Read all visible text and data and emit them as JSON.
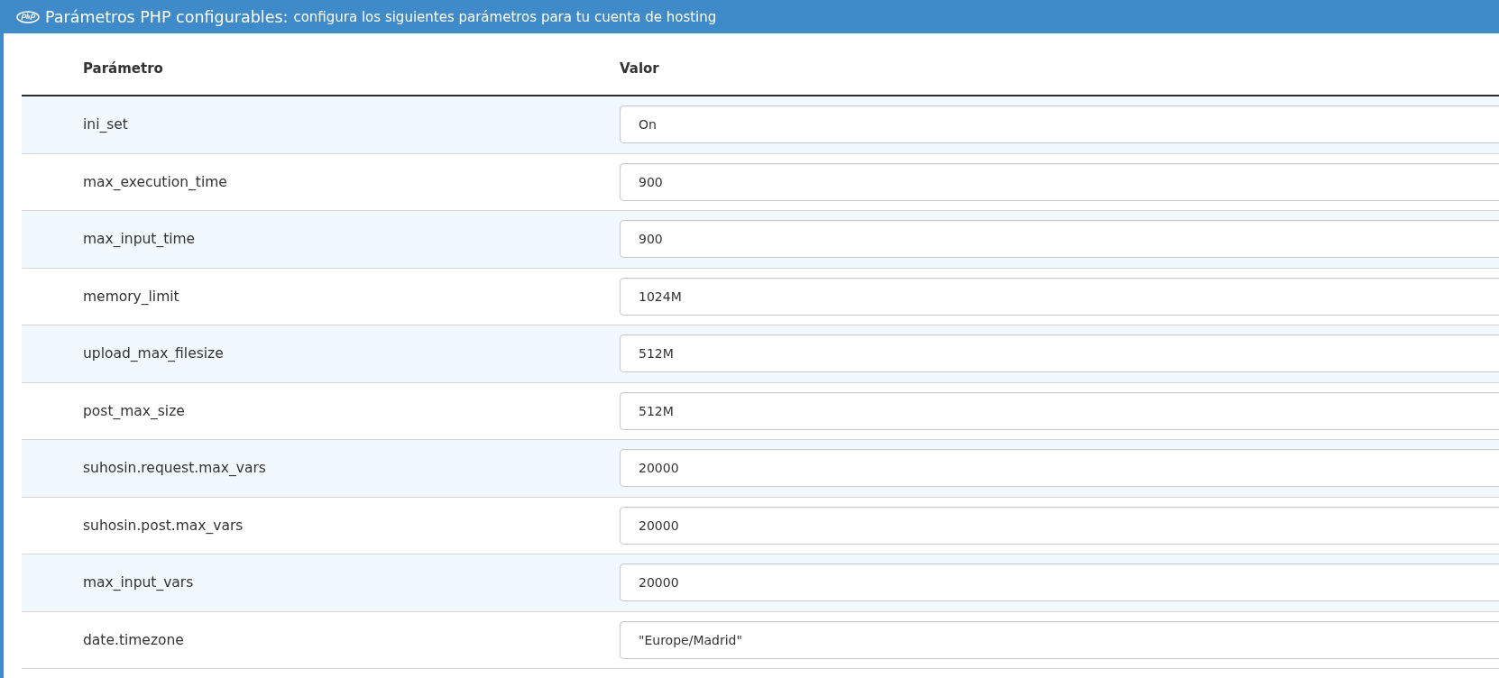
{
  "panel": {
    "title": "Parámetros PHP configurables:",
    "subtitle": "configura los siguientes parámetros para tu cuenta de hosting"
  },
  "table": {
    "columns": [
      "Parámetro",
      "Valor"
    ],
    "rows": [
      {
        "parameter": "ini_set",
        "value": "On"
      },
      {
        "parameter": "max_execution_time",
        "value": "900"
      },
      {
        "parameter": "max_input_time",
        "value": "900"
      },
      {
        "parameter": "memory_limit",
        "value": "1024M"
      },
      {
        "parameter": "upload_max_filesize",
        "value": "512M"
      },
      {
        "parameter": "post_max_size",
        "value": "512M"
      },
      {
        "parameter": "suhosin.request.max_vars",
        "value": "20000"
      },
      {
        "parameter": "suhosin.post.max_vars",
        "value": "20000"
      },
      {
        "parameter": "max_input_vars",
        "value": "20000"
      },
      {
        "parameter": "date.timezone",
        "value": "\"Europe/Madrid\""
      }
    ]
  }
}
